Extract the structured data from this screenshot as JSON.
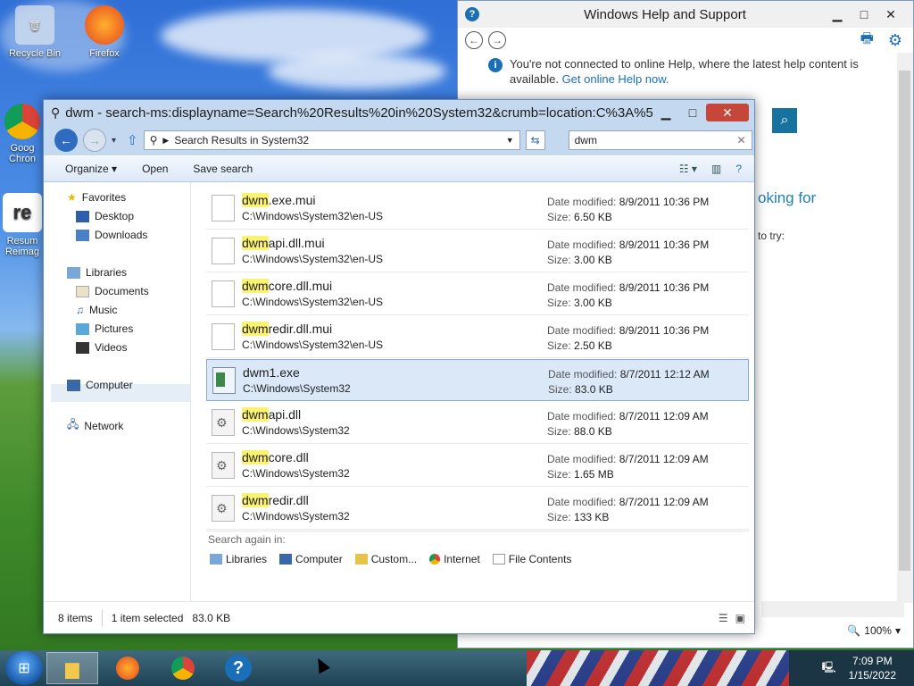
{
  "desktop": {
    "icons": [
      {
        "label": "Recycle Bin"
      },
      {
        "label": "Firefox"
      },
      {
        "label": "Goog Chron"
      },
      {
        "label": "Resum Reimag"
      }
    ]
  },
  "help": {
    "title": "Windows Help and Support",
    "message_text": "You're not connected to online Help, where the latest help content is available.",
    "link": "Get online Help now.",
    "partial_heading": "oking for",
    "partial_text": "to try:",
    "zoom": "100%"
  },
  "explorer": {
    "title": "dwm - search-ms:displayname=Search%20Results%20in%20System32&crumb=location:C%3A%5C...",
    "address": "Search Results in System32",
    "search_value": "dwm",
    "toolbar": {
      "organize": "Organize",
      "open": "Open",
      "save_search": "Save search"
    },
    "nav": {
      "favorites": "Favorites",
      "desktop": "Desktop",
      "downloads": "Downloads",
      "libraries": "Libraries",
      "documents": "Documents",
      "music": "Music",
      "pictures": "Pictures",
      "videos": "Videos",
      "computer": "Computer",
      "network": "Network"
    },
    "results": [
      {
        "match": "dwm",
        "rest": ".exe.mui",
        "path": "C:\\Windows\\System32\\en-US",
        "date_label": "Date modified:",
        "date": "8/9/2011 10:36 PM",
        "size_label": "Size:",
        "size": "6.50 KB"
      },
      {
        "match": "dwm",
        "rest": "api.dll.mui",
        "path": "C:\\Windows\\System32\\en-US",
        "date_label": "Date modified:",
        "date": "8/9/2011 10:36 PM",
        "size_label": "Size:",
        "size": "3.00 KB"
      },
      {
        "match": "dwm",
        "rest": "core.dll.mui",
        "path": "C:\\Windows\\System32\\en-US",
        "date_label": "Date modified:",
        "date": "8/9/2011 10:36 PM",
        "size_label": "Size:",
        "size": "3.00 KB"
      },
      {
        "match": "dwm",
        "rest": "redir.dll.mui",
        "path": "C:\\Windows\\System32\\en-US",
        "date_label": "Date modified:",
        "date": "8/9/2011 10:36 PM",
        "size_label": "Size:",
        "size": "2.50 KB"
      },
      {
        "match": "",
        "rest": "dwm1.exe",
        "path": "C:\\Windows\\System32",
        "date_label": "Date modified:",
        "date": "8/7/2011 12:12 AM",
        "size_label": "Size:",
        "size": "83.0 KB"
      },
      {
        "match": "dwm",
        "rest": "api.dll",
        "path": "C:\\Windows\\System32",
        "date_label": "Date modified:",
        "date": "8/7/2011 12:09 AM",
        "size_label": "Size:",
        "size": "88.0 KB"
      },
      {
        "match": "dwm",
        "rest": "core.dll",
        "path": "C:\\Windows\\System32",
        "date_label": "Date modified:",
        "date": "8/7/2011 12:09 AM",
        "size_label": "Size:",
        "size": "1.65 MB"
      },
      {
        "match": "dwm",
        "rest": "redir.dll",
        "path": "C:\\Windows\\System32",
        "date_label": "Date modified:",
        "date": "8/7/2011 12:09 AM",
        "size_label": "Size:",
        "size": "133 KB"
      }
    ],
    "search_again": {
      "label": "Search again in:",
      "items": [
        "Libraries",
        "Computer",
        "Custom...",
        "Internet",
        "File Contents"
      ]
    },
    "status": {
      "count": "8 items",
      "selected": "1 item selected",
      "selected_size": "83.0 KB"
    }
  },
  "taskbar": {
    "time": "7:09 PM",
    "date": "1/15/2022"
  }
}
